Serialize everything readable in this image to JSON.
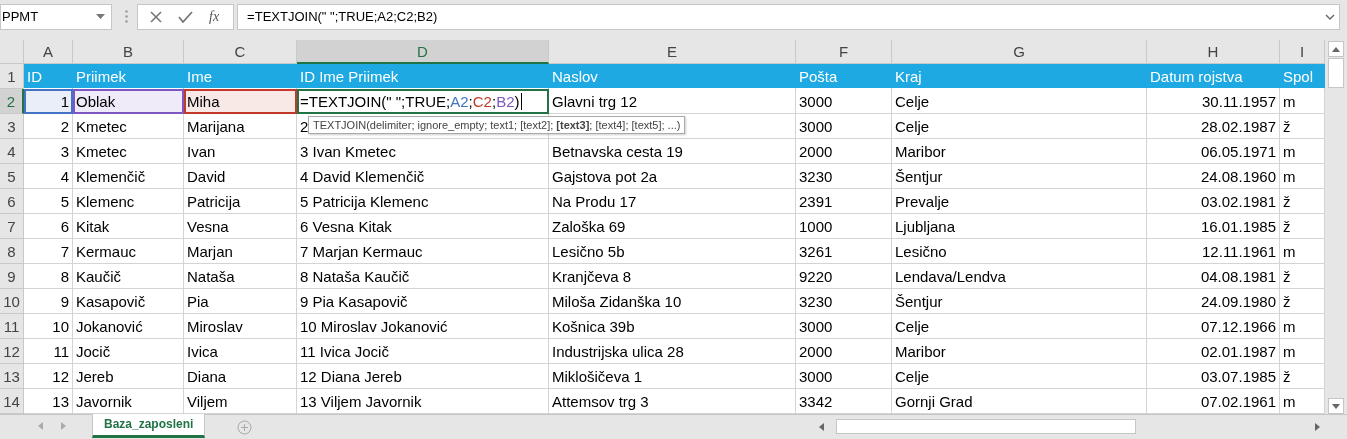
{
  "formula_bar": {
    "name_box": "PPMT",
    "insert_function": "fx",
    "formula": "=TEXTJOIN(\" \";TRUE;A2;C2;B2)"
  },
  "columns": [
    {
      "label": "A",
      "selected": false
    },
    {
      "label": "B",
      "selected": false
    },
    {
      "label": "C",
      "selected": false
    },
    {
      "label": "D",
      "selected": true
    },
    {
      "label": "E",
      "selected": false
    },
    {
      "label": "F",
      "selected": false
    },
    {
      "label": "G",
      "selected": false
    },
    {
      "label": "H",
      "selected": false
    },
    {
      "label": "I",
      "selected": false
    }
  ],
  "rows": [
    {
      "number": "1",
      "selected": false,
      "kind": "header",
      "cells": [
        "ID",
        "Priimek",
        "Ime",
        "ID Ime Priimek",
        "Naslov",
        "Pošta",
        "Kraj",
        "Datum rojstva",
        "Spol"
      ]
    },
    {
      "number": "2",
      "selected": true,
      "kind": "editing",
      "cells": [
        {
          "text": "1",
          "color": "#4472c4"
        },
        {
          "text": "Oblak",
          "color": "#7e57c2"
        },
        {
          "text": "Miha",
          "color": "#c0392b"
        },
        {
          "parts": [
            {
              "text": "=TEXTJOIN(\" \";TRUE;"
            },
            {
              "text": "A2",
              "color": "#4472c4"
            },
            {
              "text": ";"
            },
            {
              "text": "C2",
              "color": "#c0392b"
            },
            {
              "text": ";"
            },
            {
              "text": "B2",
              "color": "#7e57c2"
            },
            {
              "text": ")"
            }
          ]
        },
        "Glavni trg 12",
        "3000",
        "Celje",
        "30.11.1957",
        "m"
      ]
    },
    {
      "number": "3",
      "selected": false,
      "kind": "data",
      "cells": [
        "2",
        "Kmetec",
        "Marijana",
        "2",
        null,
        "3000",
        "Celje",
        "28.02.1987",
        "ž"
      ]
    },
    {
      "number": "4",
      "selected": false,
      "kind": "data",
      "cells": [
        "3",
        "Kmetec",
        "Ivan",
        "3 Ivan Kmetec",
        "Betnavska cesta 19",
        "2000",
        "Maribor",
        "06.05.1971",
        "m"
      ]
    },
    {
      "number": "5",
      "selected": false,
      "kind": "data",
      "cells": [
        "4",
        "Klemenčič",
        "David",
        "4 David Klemenčič",
        "Gajstova pot 2a",
        "3230",
        "Šentjur",
        "24.08.1960",
        "m"
      ]
    },
    {
      "number": "6",
      "selected": false,
      "kind": "data",
      "cells": [
        "5",
        "Klemenc",
        "Patricija",
        "5 Patricija Klemenc",
        "Na Produ 17",
        "2391",
        "Prevalje",
        "03.02.1981",
        "ž"
      ]
    },
    {
      "number": "7",
      "selected": false,
      "kind": "data",
      "cells": [
        "6",
        "Kitak",
        "Vesna",
        "6 Vesna Kitak",
        "Zaloška 69",
        "1000",
        "Ljubljana",
        "16.01.1985",
        "ž"
      ]
    },
    {
      "number": "8",
      "selected": false,
      "kind": "data",
      "cells": [
        "7",
        "Kermauc",
        "Marjan",
        "7 Marjan Kermauc",
        "Lesično 5b",
        "3261",
        "Lesično",
        "12.11.1961",
        "m"
      ]
    },
    {
      "number": "9",
      "selected": false,
      "kind": "data",
      "cells": [
        "8",
        "Kaučič",
        "Nataša",
        "8 Nataša Kaučič",
        "Kranjčeva 8",
        "9220",
        "Lendava/Lendva",
        "04.08.1981",
        "ž"
      ]
    },
    {
      "number": "10",
      "selected": false,
      "kind": "data",
      "cells": [
        "9",
        "Kasapovič",
        "Pia",
        "9 Pia Kasapovič",
        "Miloša Zidanška 10",
        "3230",
        "Šentjur",
        "24.09.1980",
        "ž"
      ]
    },
    {
      "number": "11",
      "selected": false,
      "kind": "data",
      "cells": [
        "10",
        "Jokanović",
        "Miroslav",
        "10 Miroslav Jokanović",
        "Košnica 39b",
        "3000",
        "Celje",
        "07.12.1966",
        "m"
      ]
    },
    {
      "number": "12",
      "selected": false,
      "kind": "data",
      "cells": [
        "11",
        "Jocič",
        "Ivica",
        "11 Ivica Jocič",
        "Industrijska ulica 28",
        "2000",
        "Maribor",
        "02.01.1987",
        "m"
      ]
    },
    {
      "number": "13",
      "selected": false,
      "kind": "data",
      "cells": [
        "12",
        "Jereb",
        "Diana",
        "12 Diana Jereb",
        "Miklošičeva 1",
        "3000",
        "Celje",
        "03.07.1985",
        "ž"
      ]
    },
    {
      "number": "14",
      "selected": false,
      "kind": "data",
      "cells": [
        "13",
        "Javornik",
        "Viljem",
        "13 Viljem Javornik",
        "Attemsov trg 3",
        "3342",
        "Gornji Grad",
        "07.02.1961",
        "m"
      ]
    }
  ],
  "tooltip": "TEXTJOIN(delimiter; ignore_empty; text1; [text2]; **[text3]**; [text4]; [text5]; ...)",
  "sheet_tabs": [
    {
      "label": "Baza_zaposleni",
      "selected": true
    }
  ]
}
